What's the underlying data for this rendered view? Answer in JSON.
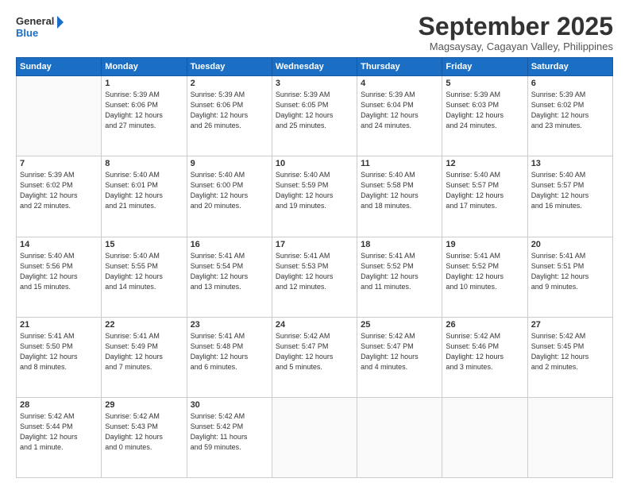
{
  "logo": {
    "line1": "General",
    "line2": "Blue"
  },
  "title": "September 2025",
  "location": "Magsaysay, Cagayan Valley, Philippines",
  "days_header": [
    "Sunday",
    "Monday",
    "Tuesday",
    "Wednesday",
    "Thursday",
    "Friday",
    "Saturday"
  ],
  "weeks": [
    [
      {
        "num": "",
        "info": ""
      },
      {
        "num": "1",
        "info": "Sunrise: 5:39 AM\nSunset: 6:06 PM\nDaylight: 12 hours\nand 27 minutes."
      },
      {
        "num": "2",
        "info": "Sunrise: 5:39 AM\nSunset: 6:06 PM\nDaylight: 12 hours\nand 26 minutes."
      },
      {
        "num": "3",
        "info": "Sunrise: 5:39 AM\nSunset: 6:05 PM\nDaylight: 12 hours\nand 25 minutes."
      },
      {
        "num": "4",
        "info": "Sunrise: 5:39 AM\nSunset: 6:04 PM\nDaylight: 12 hours\nand 24 minutes."
      },
      {
        "num": "5",
        "info": "Sunrise: 5:39 AM\nSunset: 6:03 PM\nDaylight: 12 hours\nand 24 minutes."
      },
      {
        "num": "6",
        "info": "Sunrise: 5:39 AM\nSunset: 6:02 PM\nDaylight: 12 hours\nand 23 minutes."
      }
    ],
    [
      {
        "num": "7",
        "info": "Sunrise: 5:39 AM\nSunset: 6:02 PM\nDaylight: 12 hours\nand 22 minutes."
      },
      {
        "num": "8",
        "info": "Sunrise: 5:40 AM\nSunset: 6:01 PM\nDaylight: 12 hours\nand 21 minutes."
      },
      {
        "num": "9",
        "info": "Sunrise: 5:40 AM\nSunset: 6:00 PM\nDaylight: 12 hours\nand 20 minutes."
      },
      {
        "num": "10",
        "info": "Sunrise: 5:40 AM\nSunset: 5:59 PM\nDaylight: 12 hours\nand 19 minutes."
      },
      {
        "num": "11",
        "info": "Sunrise: 5:40 AM\nSunset: 5:58 PM\nDaylight: 12 hours\nand 18 minutes."
      },
      {
        "num": "12",
        "info": "Sunrise: 5:40 AM\nSunset: 5:57 PM\nDaylight: 12 hours\nand 17 minutes."
      },
      {
        "num": "13",
        "info": "Sunrise: 5:40 AM\nSunset: 5:57 PM\nDaylight: 12 hours\nand 16 minutes."
      }
    ],
    [
      {
        "num": "14",
        "info": "Sunrise: 5:40 AM\nSunset: 5:56 PM\nDaylight: 12 hours\nand 15 minutes."
      },
      {
        "num": "15",
        "info": "Sunrise: 5:40 AM\nSunset: 5:55 PM\nDaylight: 12 hours\nand 14 minutes."
      },
      {
        "num": "16",
        "info": "Sunrise: 5:41 AM\nSunset: 5:54 PM\nDaylight: 12 hours\nand 13 minutes."
      },
      {
        "num": "17",
        "info": "Sunrise: 5:41 AM\nSunset: 5:53 PM\nDaylight: 12 hours\nand 12 minutes."
      },
      {
        "num": "18",
        "info": "Sunrise: 5:41 AM\nSunset: 5:52 PM\nDaylight: 12 hours\nand 11 minutes."
      },
      {
        "num": "19",
        "info": "Sunrise: 5:41 AM\nSunset: 5:52 PM\nDaylight: 12 hours\nand 10 minutes."
      },
      {
        "num": "20",
        "info": "Sunrise: 5:41 AM\nSunset: 5:51 PM\nDaylight: 12 hours\nand 9 minutes."
      }
    ],
    [
      {
        "num": "21",
        "info": "Sunrise: 5:41 AM\nSunset: 5:50 PM\nDaylight: 12 hours\nand 8 minutes."
      },
      {
        "num": "22",
        "info": "Sunrise: 5:41 AM\nSunset: 5:49 PM\nDaylight: 12 hours\nand 7 minutes."
      },
      {
        "num": "23",
        "info": "Sunrise: 5:41 AM\nSunset: 5:48 PM\nDaylight: 12 hours\nand 6 minutes."
      },
      {
        "num": "24",
        "info": "Sunrise: 5:42 AM\nSunset: 5:47 PM\nDaylight: 12 hours\nand 5 minutes."
      },
      {
        "num": "25",
        "info": "Sunrise: 5:42 AM\nSunset: 5:47 PM\nDaylight: 12 hours\nand 4 minutes."
      },
      {
        "num": "26",
        "info": "Sunrise: 5:42 AM\nSunset: 5:46 PM\nDaylight: 12 hours\nand 3 minutes."
      },
      {
        "num": "27",
        "info": "Sunrise: 5:42 AM\nSunset: 5:45 PM\nDaylight: 12 hours\nand 2 minutes."
      }
    ],
    [
      {
        "num": "28",
        "info": "Sunrise: 5:42 AM\nSunset: 5:44 PM\nDaylight: 12 hours\nand 1 minute."
      },
      {
        "num": "29",
        "info": "Sunrise: 5:42 AM\nSunset: 5:43 PM\nDaylight: 12 hours\nand 0 minutes."
      },
      {
        "num": "30",
        "info": "Sunrise: 5:42 AM\nSunset: 5:42 PM\nDaylight: 11 hours\nand 59 minutes."
      },
      {
        "num": "",
        "info": ""
      },
      {
        "num": "",
        "info": ""
      },
      {
        "num": "",
        "info": ""
      },
      {
        "num": "",
        "info": ""
      }
    ]
  ]
}
